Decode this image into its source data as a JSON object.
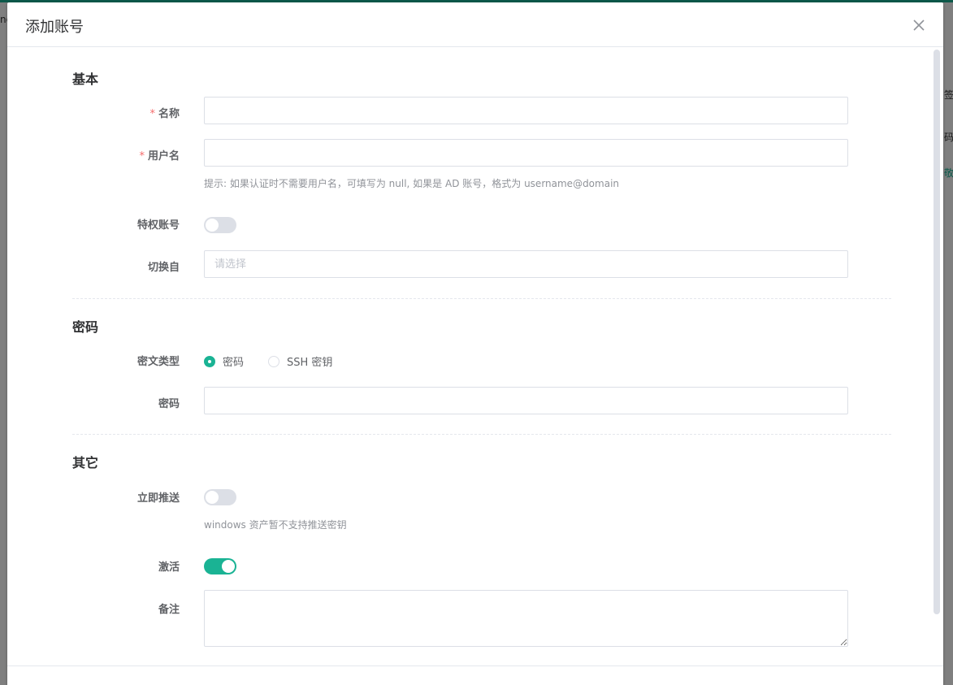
{
  "background": {
    "fragments": [
      "ne",
      "签",
      "码",
      "敬"
    ]
  },
  "dialog": {
    "title": "添加账号",
    "close_icon": "close-icon"
  },
  "sections": {
    "basic": "基本",
    "password": "密码",
    "other": "其它"
  },
  "basic": {
    "name_label": "名称",
    "name_value": "",
    "username_label": "用户名",
    "username_value": "",
    "username_hint": "提示: 如果认证时不需要用户名，可填写为 null, 如果是 AD 账号，格式为 username@domain",
    "privileged_label": "特权账号",
    "privileged_on": false,
    "su_from_label": "切换自",
    "su_from_placeholder": "请选择"
  },
  "password": {
    "secret_type_label": "密文类型",
    "options": [
      "密码",
      "SSH 密钥"
    ],
    "selected": "密码",
    "password_label": "密码",
    "password_value": ""
  },
  "other": {
    "push_now_label": "立即推送",
    "push_now_on": false,
    "push_hint": "windows 资产暂不支持推送密钥",
    "active_label": "激活",
    "active_on": true,
    "comment_label": "备注",
    "comment_value": ""
  },
  "required_mark": "*",
  "colors": {
    "accent": "#1ab394",
    "required": "#f56c6c",
    "border": "#dcdfe6"
  }
}
